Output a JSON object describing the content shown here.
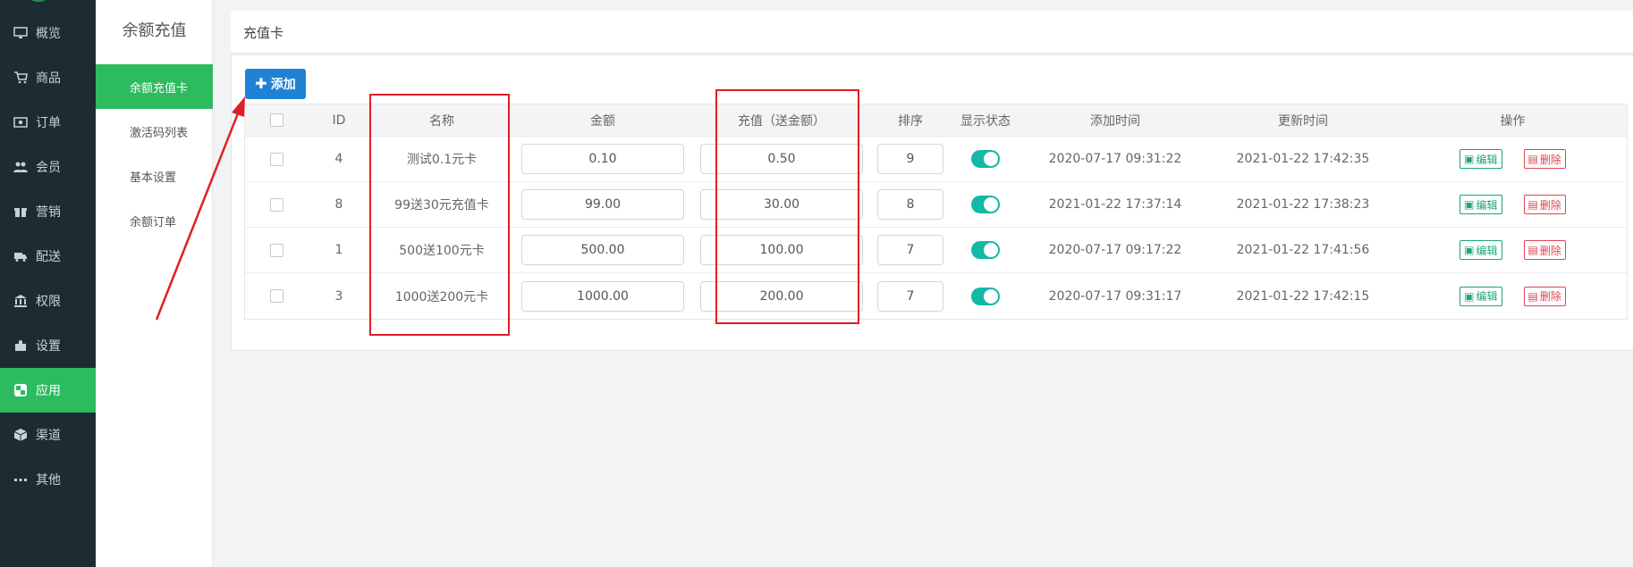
{
  "nav": {
    "items": [
      {
        "label": "概览",
        "icon": "monitor-icon"
      },
      {
        "label": "商品",
        "icon": "cart-icon"
      },
      {
        "label": "订单",
        "icon": "money-icon"
      },
      {
        "label": "会员",
        "icon": "users-icon"
      },
      {
        "label": "营销",
        "icon": "gift-icon"
      },
      {
        "label": "配送",
        "icon": "truck-icon"
      },
      {
        "label": "权限",
        "icon": "bank-icon"
      },
      {
        "label": "设置",
        "icon": "puzzle-icon"
      },
      {
        "label": "应用",
        "icon": "app-icon",
        "active": true
      },
      {
        "label": "渠道",
        "icon": "cube-icon"
      },
      {
        "label": "其他",
        "icon": "more-icon"
      }
    ]
  },
  "submenu": {
    "title": "余额充值",
    "items": [
      {
        "label": "余额充值卡",
        "active": true
      },
      {
        "label": "激活码列表"
      },
      {
        "label": "基本设置"
      },
      {
        "label": "余额订单"
      }
    ]
  },
  "panel": {
    "title": "充值卡",
    "add_label": "添加"
  },
  "table": {
    "headers": {
      "id": "ID",
      "name": "名称",
      "amount": "金额",
      "recharge": "充值（送金额）",
      "sort": "排序",
      "status": "显示状态",
      "created": "添加时间",
      "updated": "更新时间",
      "actions": "操作"
    },
    "rows": [
      {
        "id": "4",
        "name": "测试0.1元卡",
        "amount": "0.10",
        "recharge": "0.50",
        "sort": "9",
        "status": true,
        "created": "2020-07-17 09:31:22",
        "updated": "2021-01-22 17:42:35"
      },
      {
        "id": "8",
        "name": "99送30元充值卡",
        "amount": "99.00",
        "recharge": "30.00",
        "sort": "8",
        "status": true,
        "created": "2021-01-22 17:37:14",
        "updated": "2021-01-22 17:38:23"
      },
      {
        "id": "1",
        "name": "500送100元卡",
        "amount": "500.00",
        "recharge": "100.00",
        "sort": "7",
        "status": true,
        "created": "2020-07-17 09:17:22",
        "updated": "2021-01-22 17:41:56"
      },
      {
        "id": "3",
        "name": "1000送200元卡",
        "amount": "1000.00",
        "recharge": "200.00",
        "sort": "7",
        "status": true,
        "created": "2020-07-17 09:31:17",
        "updated": "2021-01-22 17:42:15"
      }
    ],
    "edit_label": "编辑",
    "delete_label": "删除"
  },
  "colors": {
    "accent_green": "#2dbb5f",
    "nav_bg": "#1d2b33",
    "primary_blue": "#1f82d4",
    "toggle_teal": "#14b8a6",
    "annotation_red": "#e01e26"
  }
}
